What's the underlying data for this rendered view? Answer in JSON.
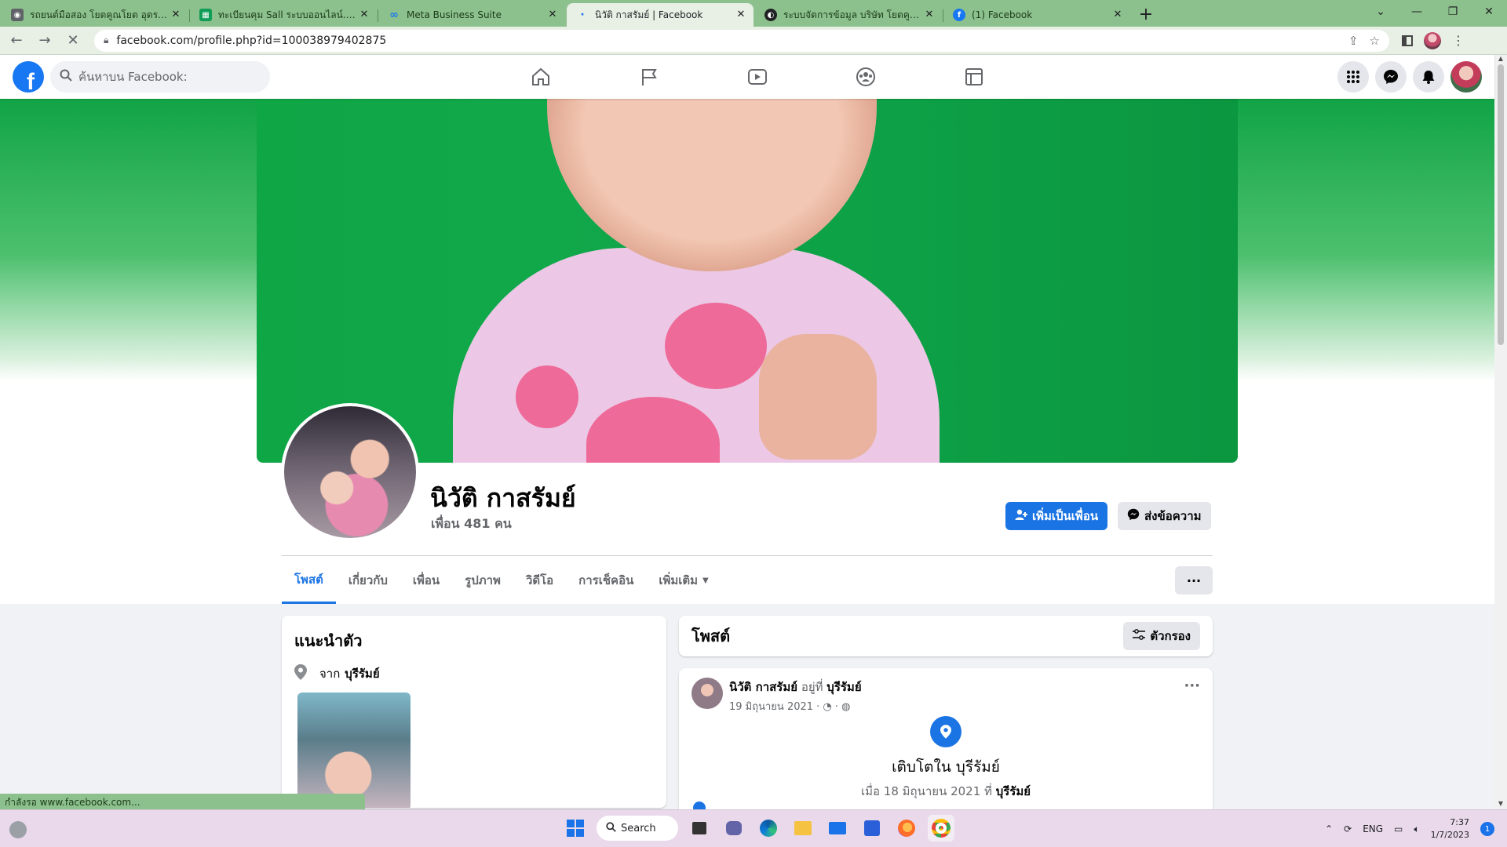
{
  "browser": {
    "tabs": [
      {
        "title": "รถยนต์มือสอง โยตคูณโยต อุดรธานี",
        "icon": "site-icon",
        "color": "#5f6368",
        "active": false
      },
      {
        "title": "ทะเบียนคุม Sall ระบบออนไลน์.xlsx - G",
        "icon": "sheets-icon",
        "color": "#0f9d58",
        "active": false
      },
      {
        "title": "Meta Business Suite",
        "icon": "meta-icon",
        "color": "#1877f2",
        "active": false
      },
      {
        "title": "นิวัติ กาสรัมย์ | Facebook",
        "icon": "loading-icon",
        "color": "#1a73e8",
        "active": true
      },
      {
        "title": "ระบบจัดการข้อมูล บริษัท โยตคูณโยต",
        "icon": "globe-icon",
        "color": "#202124",
        "active": false
      },
      {
        "title": "(1) Facebook",
        "icon": "facebook-icon",
        "color": "#1877f2",
        "active": false
      }
    ],
    "url": "facebook.com/profile.php?id=100038979402875",
    "status_text": "กำลังรอ www.facebook.com..."
  },
  "fb": {
    "logo": "f",
    "search_placeholder": "ค้นหาบน Facebook:",
    "nav": [
      "home-icon",
      "flag-icon",
      "video-icon",
      "groups-icon",
      "gaming-icon"
    ]
  },
  "profile": {
    "name": "นิวัติ กาสรัมย์",
    "friends": "เพื่อน 481 คน",
    "add_friend": "เพิ่มเป็นเพื่อน",
    "message": "ส่งข้อความ",
    "tabs": [
      "โพสต์",
      "เกี่ยวกับ",
      "เพื่อน",
      "รูปภาพ",
      "วิดีโอ",
      "การเช็คอิน",
      "เพิ่มเติม"
    ],
    "more_button": "···"
  },
  "intro": {
    "title": "แนะนำตัว",
    "from_label": "จาก",
    "from_place": "บุรีรัมย์"
  },
  "posts": {
    "title": "โพสต์",
    "filter": "ตัวกรอง",
    "post": {
      "author": "นิวัติ กาสรัมย์",
      "lives_in": "อยู่ที่",
      "place": "บุรีรัมย์",
      "date": "19 มิถุนายน 2021 · ",
      "life_event": "เติบโตใน บุรีรัมย์",
      "life_when": "เมื่อ 18 มิถุนายน 2021 ที่",
      "life_place": "บุรีรัมย์"
    }
  },
  "taskbar": {
    "search": "Search",
    "lang": "ENG",
    "time": "7:37",
    "date": "1/7/2023",
    "notifications": "1"
  }
}
